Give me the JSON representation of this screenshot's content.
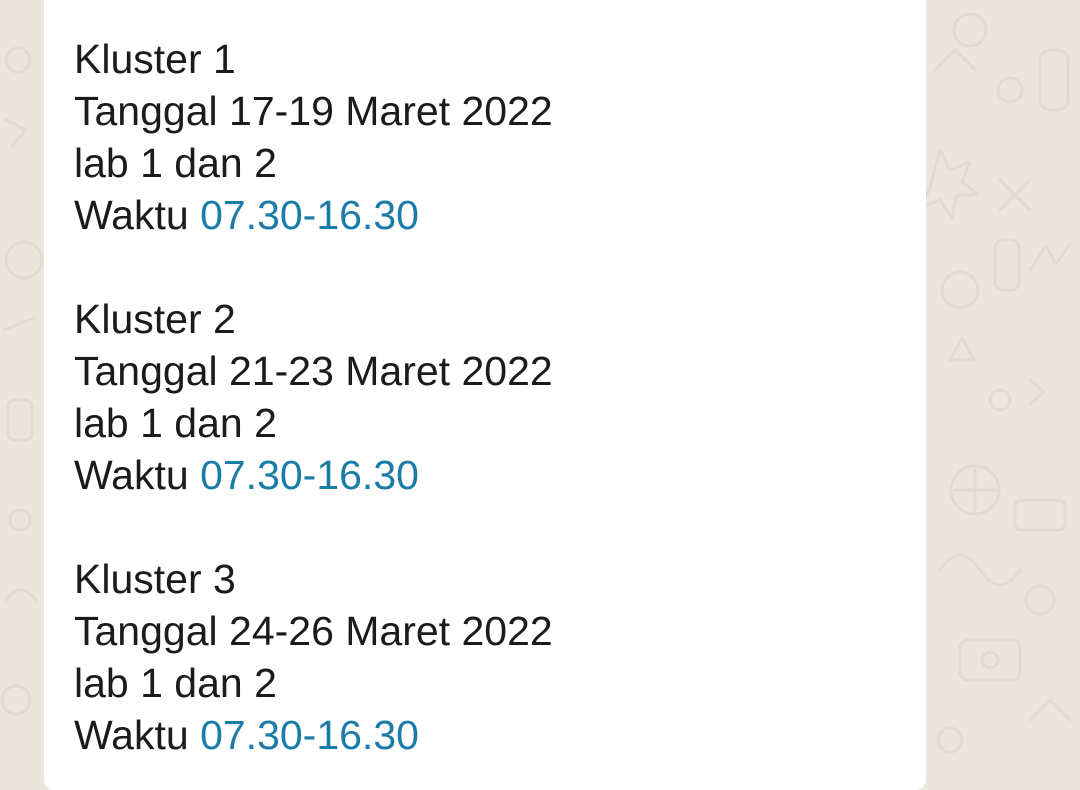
{
  "message": {
    "clusters": [
      {
        "title": "Kluster 1",
        "date": "Tanggal 17-19 Maret 2022",
        "lab": "lab 1 dan 2",
        "time_prefix": "Waktu ",
        "time": "07.30-16.30"
      },
      {
        "title": "Kluster 2",
        "date": "Tanggal 21-23 Maret 2022",
        "lab": "lab 1 dan 2",
        "time_prefix": "Waktu ",
        "time": "07.30-16.30"
      },
      {
        "title": "Kluster 3",
        "date": "Tanggal 24-26 Maret 2022",
        "lab": "lab 1 dan 2",
        "time_prefix": "Waktu ",
        "time": "07.30-16.30"
      }
    ]
  },
  "colors": {
    "chat_background": "#ece5dd",
    "bubble": "#ffffff",
    "text": "#1b1b1b",
    "link": "#1b7da7"
  }
}
